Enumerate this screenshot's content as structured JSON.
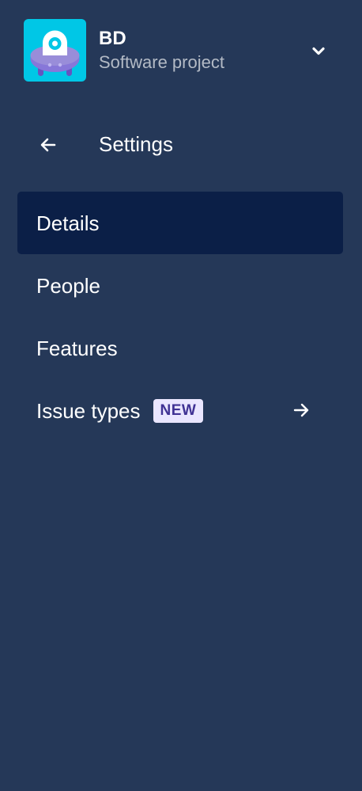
{
  "project": {
    "name": "BD",
    "type": "Software project",
    "avatar_icon": "ufo-robot-icon",
    "avatar_color": "#00C7E6",
    "expand_icon": "chevron-down-icon"
  },
  "settings": {
    "back_icon": "arrow-left-icon",
    "title": "Settings"
  },
  "nav": {
    "items": [
      {
        "label": "Details",
        "active": true
      },
      {
        "label": "People",
        "active": false
      },
      {
        "label": "Features",
        "active": false
      },
      {
        "label": "Issue types",
        "active": false,
        "badge": "NEW",
        "trailing_icon": "arrow-right-icon"
      }
    ]
  },
  "colors": {
    "sidebar_bg": "#253858",
    "active_item_bg": "#0B1F47",
    "subtitle_text": "#B3BAC5",
    "badge_bg": "#EAE6FF",
    "badge_text": "#403294"
  }
}
